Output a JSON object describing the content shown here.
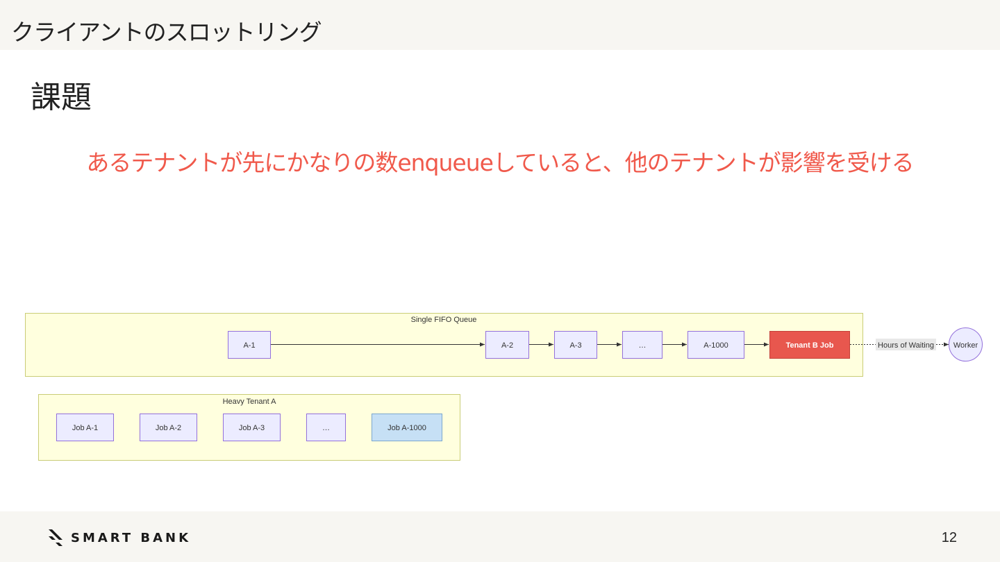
{
  "header": {
    "title": "クライアントのスロットリング"
  },
  "slide": {
    "heading": "課題",
    "message": "あるテナントが先にかなりの数enqueueしていると、他のテナントが影響を受ける"
  },
  "diagram": {
    "queue": {
      "label": "Single FIFO Queue",
      "nodes": [
        "A-1",
        "A-2",
        "A-3",
        "…",
        "A-1000"
      ],
      "blocked_job": "Tenant B Job"
    },
    "wait_label": "Hours of Waiting",
    "worker": "Worker",
    "heavy_tenant": {
      "label": "Heavy Tenant A",
      "jobs": [
        "Job A-1",
        "Job A-2",
        "Job A-3",
        "…",
        "Job A-1000"
      ]
    },
    "colors": {
      "cluster_fill": "#ffffde",
      "cluster_stroke": "#c9cc76",
      "node_fill": "#ececff",
      "node_stroke": "#9370db",
      "blocked_fill": "#e8574e",
      "highlight_fill": "#c6e0f5"
    }
  },
  "footer": {
    "brand": "SMART BANK",
    "page_number": "12"
  }
}
